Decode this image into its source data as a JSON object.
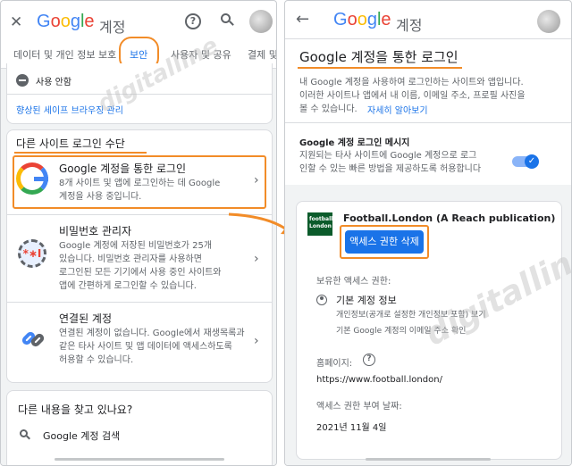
{
  "left": {
    "header": {
      "title_google": "Google",
      "title_suffix": "계정",
      "close_glyph": "✕",
      "help_glyph": "?",
      "search_glyph": "⚲"
    },
    "tabs": [
      {
        "label": "데이터 및 개인 정보 보호"
      },
      {
        "label": "보안"
      },
      {
        "label": "사용자 및 공유"
      },
      {
        "label": "결제 및"
      }
    ],
    "partial_card": {
      "status_label": "사용 안함",
      "safe_browsing_link": "향상된 세이프 브라우징 관리"
    },
    "section_title": "다른 사이트 로그인 수단",
    "items": [
      {
        "title": "Google 계정을 통한 로그인",
        "desc1": "8개 사이트 및 앱에 로그인하는 데 Google",
        "desc2": "계정을 사용 중입니다."
      },
      {
        "title": "비밀번호 관리자",
        "desc1": "Google 계정에 저장된 비밀번호가 25개",
        "desc2": "있습니다. 비밀번호 관리자를 사용하면",
        "desc3": "로그인된 모든 기기에서 사용 중인 사이트와",
        "desc4": "앱에 간편하게 로그인할 수 있습니다.",
        "icon_text": "*∗I"
      },
      {
        "title": "연결된 계정",
        "desc1": "연결된 계정이 없습니다. Google에서 재생목록과",
        "desc2": "같은 타사 사이트 및 앱 데이터에 액세스하도록",
        "desc3": "허용할 수 있습니다."
      }
    ],
    "find_more": {
      "title": "다른 내용을 찾고 있나요?",
      "search_label": "Google 계정 검색"
    }
  },
  "right": {
    "header": {
      "back_glyph": "←",
      "title_google": "Google",
      "title_suffix": "계정"
    },
    "page_title": "Google 계정을 통한 로그인",
    "intro1": "내 Google 계정을 사용하여 로그인하는 사이트와 앱입니다.",
    "intro2": "이러한 사이트나 앱에서 내 이름, 이메일 주소, 프로필 사진을",
    "intro3": "볼 수 있습니다.",
    "learn_more": "자세히 알아보기",
    "prompt": {
      "title": "Google 계정 로그인 메시지",
      "desc1": "지원되는 타사 사이트에 Google 계정으로 로그",
      "desc2": "인할 수 있는 빠른 방법을 제공하도록 허용합니다",
      "toggle_on": true,
      "check_glyph": "✓"
    },
    "app": {
      "logo_line1": "football",
      "logo_line2": "London",
      "name": "Football.London (A Reach publication)",
      "revoke_button": "액세스 권한 삭제",
      "access_heading": "보유한 액세스 권한:",
      "access_item": "기본 계정 정보",
      "access_detail1": "개인정보(공개로 설정한 개인정보 포함) 보기",
      "access_detail2": "기본 Google 계정의 이메일 주소 확인",
      "homepage_label": "홈페이지:",
      "homepage_url": "https://www.football.london/",
      "granted_label": "액세스 권한 부여 날짜:",
      "granted_date": "2021년 11월 4일"
    }
  },
  "watermark": "digitalline",
  "colors": {
    "accent": "#1a73e8",
    "highlight": "#f28c28",
    "google_blue": "#4285f4",
    "google_red": "#ea4335",
    "google_yellow": "#fbbc05",
    "google_green": "#34a853"
  }
}
